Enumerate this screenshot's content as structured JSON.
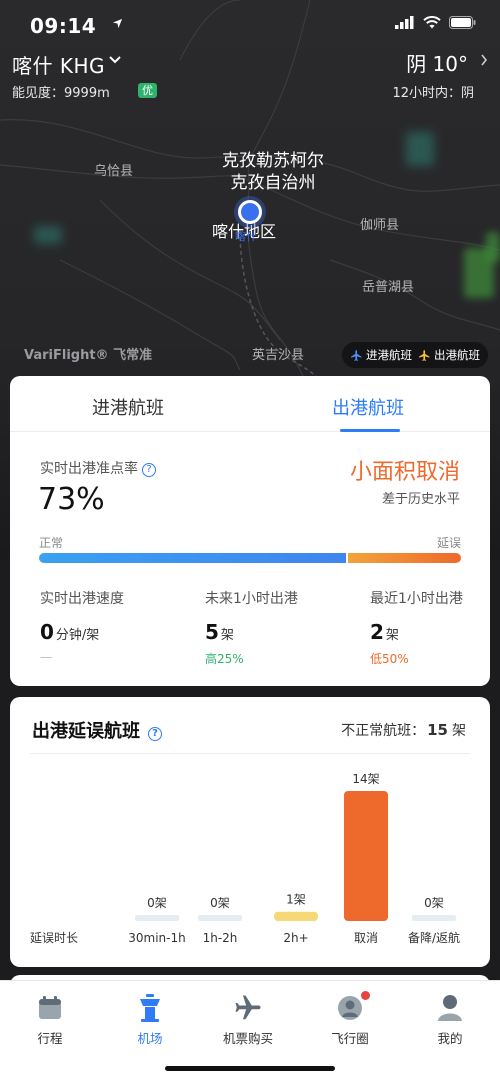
{
  "status_bar": {
    "time": "09:14"
  },
  "location": {
    "name": "喀什 KHG",
    "weather": "阴 10°",
    "visibility": "能见度：9999m",
    "visibility_badge": "优",
    "forecast": "12小时内：阴"
  },
  "map": {
    "labels": {
      "wuqia": "乌恰县",
      "kezhou_1": "克孜勒苏柯尔",
      "kezhou_2": "克孜自治州",
      "kashgar": "喀什地区",
      "kashgar_sub": "喀什",
      "jiashi": "伽师县",
      "yuepuhu": "岳普湖县",
      "yingjisha": "英吉沙县"
    },
    "brand": "VariFlight® 飞常准",
    "legend": {
      "arrivals": "进港航班",
      "departures": "出港航班"
    }
  },
  "departures_card": {
    "tabs": [
      "进港航班",
      "出港航班"
    ],
    "rate_label": "实时出港准点率",
    "rate_value": "73%",
    "status": "小面积取消",
    "status_sub": "差于历史水平",
    "bar_label_normal": "正常",
    "bar_label_delay": "延误",
    "bar_normal_fraction": 0.73,
    "stats": [
      {
        "title": "实时出港速度",
        "value": "0",
        "unit": "分钟/架",
        "change": "—",
        "change_color": "#bbbbbb"
      },
      {
        "title": "未来1小时出港",
        "value": "5",
        "unit": "架",
        "change": "高25%",
        "change_color": "#2fb36c"
      },
      {
        "title": "最近1小时出港",
        "value": "2",
        "unit": "架",
        "change": "低50%",
        "change_color": "#ee6a2c"
      }
    ]
  },
  "delay_card": {
    "title": "出港延误航班",
    "abnormal_label": "不正常航班：",
    "abnormal_value": "15",
    "abnormal_unit": "架"
  },
  "chart_data": {
    "type": "bar",
    "xlabel": "延误时长",
    "categories": [
      "30min-1h",
      "1h-2h",
      "2h+",
      "取消",
      "备降/返航"
    ],
    "values": [
      0,
      0,
      1,
      14,
      0
    ],
    "value_labels": [
      "0架",
      "0架",
      "1架",
      "14架",
      "0架"
    ],
    "colors": [
      "#e4edf1",
      "#e4edf1",
      "#f7d877",
      "#ee6a2c",
      "#e4edf1"
    ]
  },
  "nav": {
    "items": [
      {
        "label": "行程"
      },
      {
        "label": "机场"
      },
      {
        "label": "机票购买"
      },
      {
        "label": "飞行圈"
      },
      {
        "label": "我的"
      }
    ],
    "active": "机场"
  },
  "colors": {
    "accent": "#2f7cf6",
    "orange": "#ee6a2c",
    "green": "#2fb36c"
  }
}
